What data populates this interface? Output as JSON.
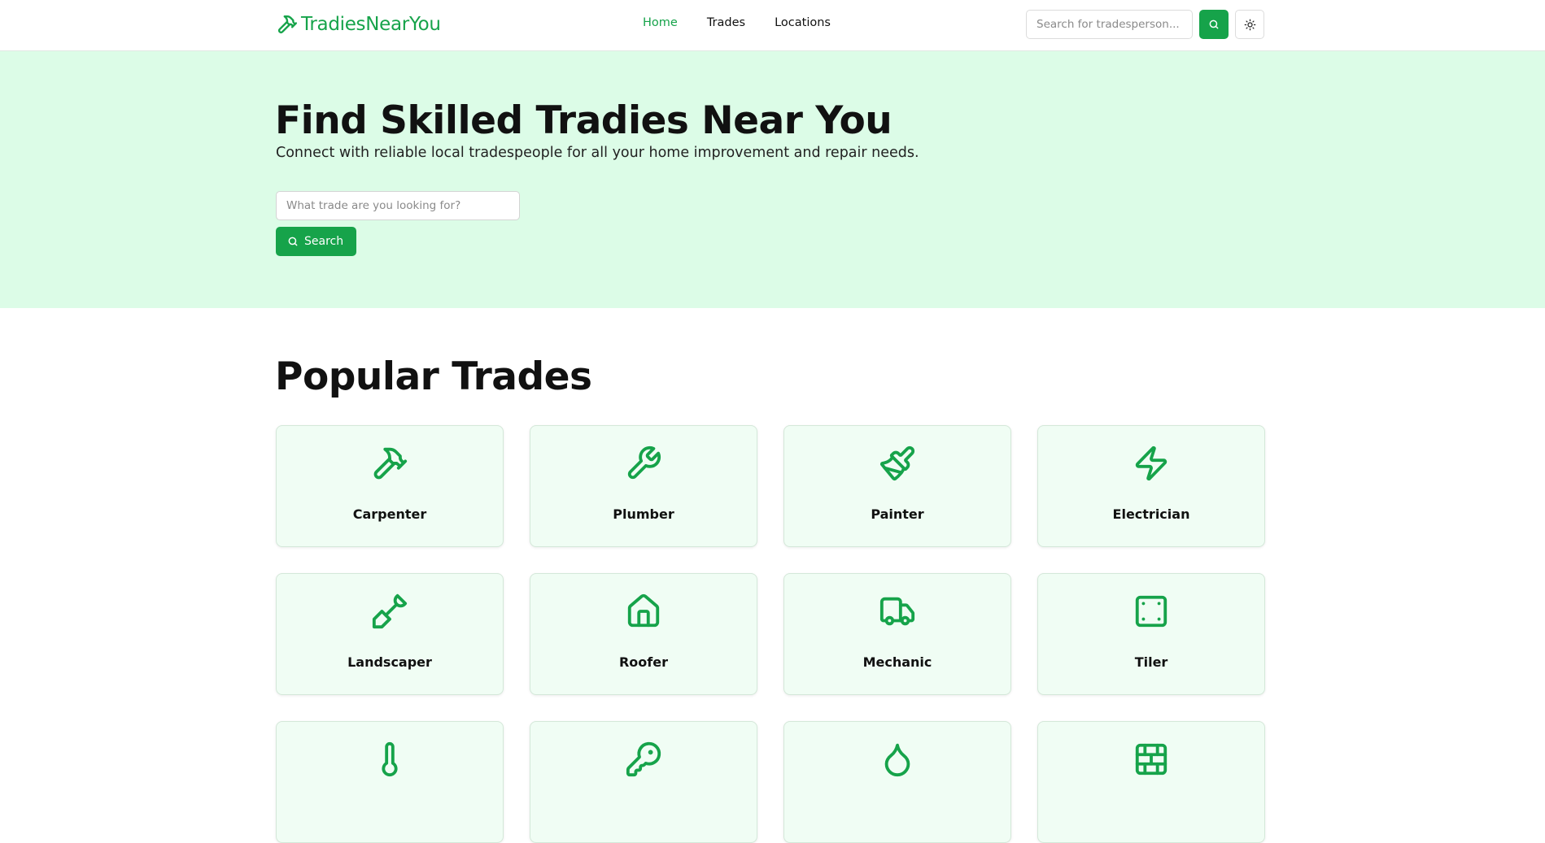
{
  "brand": {
    "name": "TradiesNearYou",
    "accent": "#16a34a",
    "hero_bg": "#dcfce7",
    "card_bg": "#f0fdf4"
  },
  "nav": [
    {
      "label": "Home",
      "active": true
    },
    {
      "label": "Trades",
      "active": false
    },
    {
      "label": "Locations",
      "active": false
    }
  ],
  "header": {
    "search_placeholder": "Search for tradesperson...",
    "search_icon": "search-icon",
    "theme_icon": "sun-icon"
  },
  "hero": {
    "title": "Find Skilled Tradies Near You",
    "subtitle": "Connect with reliable local tradespeople for all your home improvement and repair needs.",
    "input_placeholder": "What trade are you looking for?",
    "button_label": "Search"
  },
  "popular": {
    "title": "Popular Trades",
    "trades": [
      {
        "label": "Carpenter",
        "icon": "hammer-icon"
      },
      {
        "label": "Plumber",
        "icon": "wrench-icon"
      },
      {
        "label": "Painter",
        "icon": "paintbrush-icon"
      },
      {
        "label": "Electrician",
        "icon": "lightning-icon"
      },
      {
        "label": "Landscaper",
        "icon": "shovel-icon"
      },
      {
        "label": "Roofer",
        "icon": "house-icon"
      },
      {
        "label": "Mechanic",
        "icon": "truck-icon"
      },
      {
        "label": "Tiler",
        "icon": "tile-icon"
      },
      {
        "label": "",
        "icon": "thermometer-icon"
      },
      {
        "label": "",
        "icon": "key-icon"
      },
      {
        "label": "",
        "icon": "droplet-icon"
      },
      {
        "label": "",
        "icon": "brick-wall-icon"
      }
    ]
  }
}
